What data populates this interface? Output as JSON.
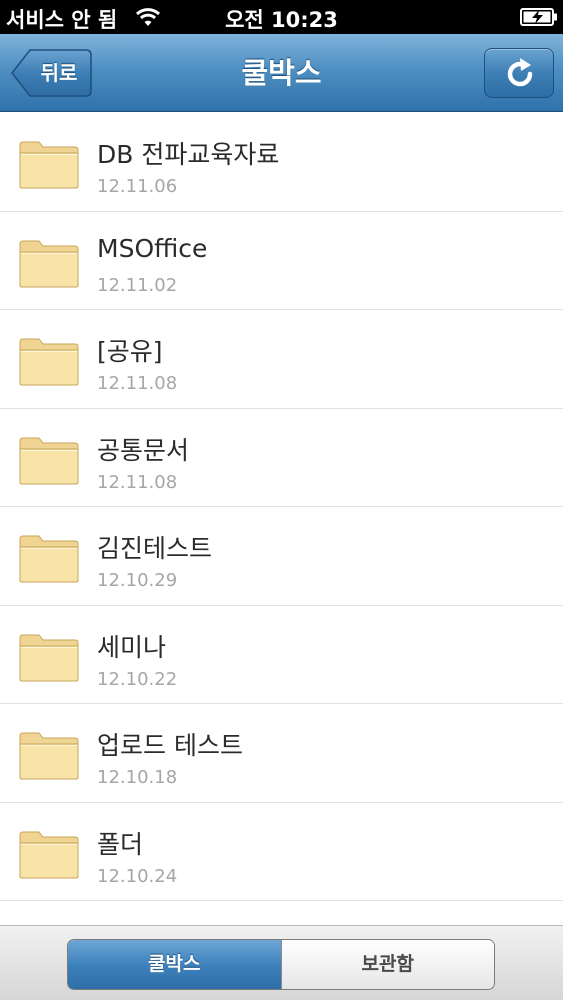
{
  "status_bar": {
    "carrier": "서비스 안 됨",
    "time": "오전 10:23",
    "wifi_icon": "wifi-icon",
    "battery_icon": "battery-charging-icon"
  },
  "nav_bar": {
    "title": "쿨박스",
    "back_label": "뒤로",
    "refresh_icon": "refresh-icon"
  },
  "files": [
    {
      "name": "DB 전파교육자료",
      "date": "12.11.06"
    },
    {
      "name": "MSOffice",
      "date": "12.11.02"
    },
    {
      "name": "[공유]",
      "date": "12.11.08"
    },
    {
      "name": "공통문서",
      "date": "12.11.08"
    },
    {
      "name": "김진테스트",
      "date": "12.10.29"
    },
    {
      "name": "세미나",
      "date": "12.10.22"
    },
    {
      "name": "업로드 테스트",
      "date": "12.10.18"
    },
    {
      "name": "폴더",
      "date": "12.10.24"
    }
  ],
  "tabs": [
    {
      "label": "쿨박스",
      "selected": true
    },
    {
      "label": "보관함",
      "selected": false
    }
  ],
  "colors": {
    "nav_bar": "#4f8fc2",
    "folder": "#f5dfa0",
    "active_tab": "#3e82bd"
  }
}
